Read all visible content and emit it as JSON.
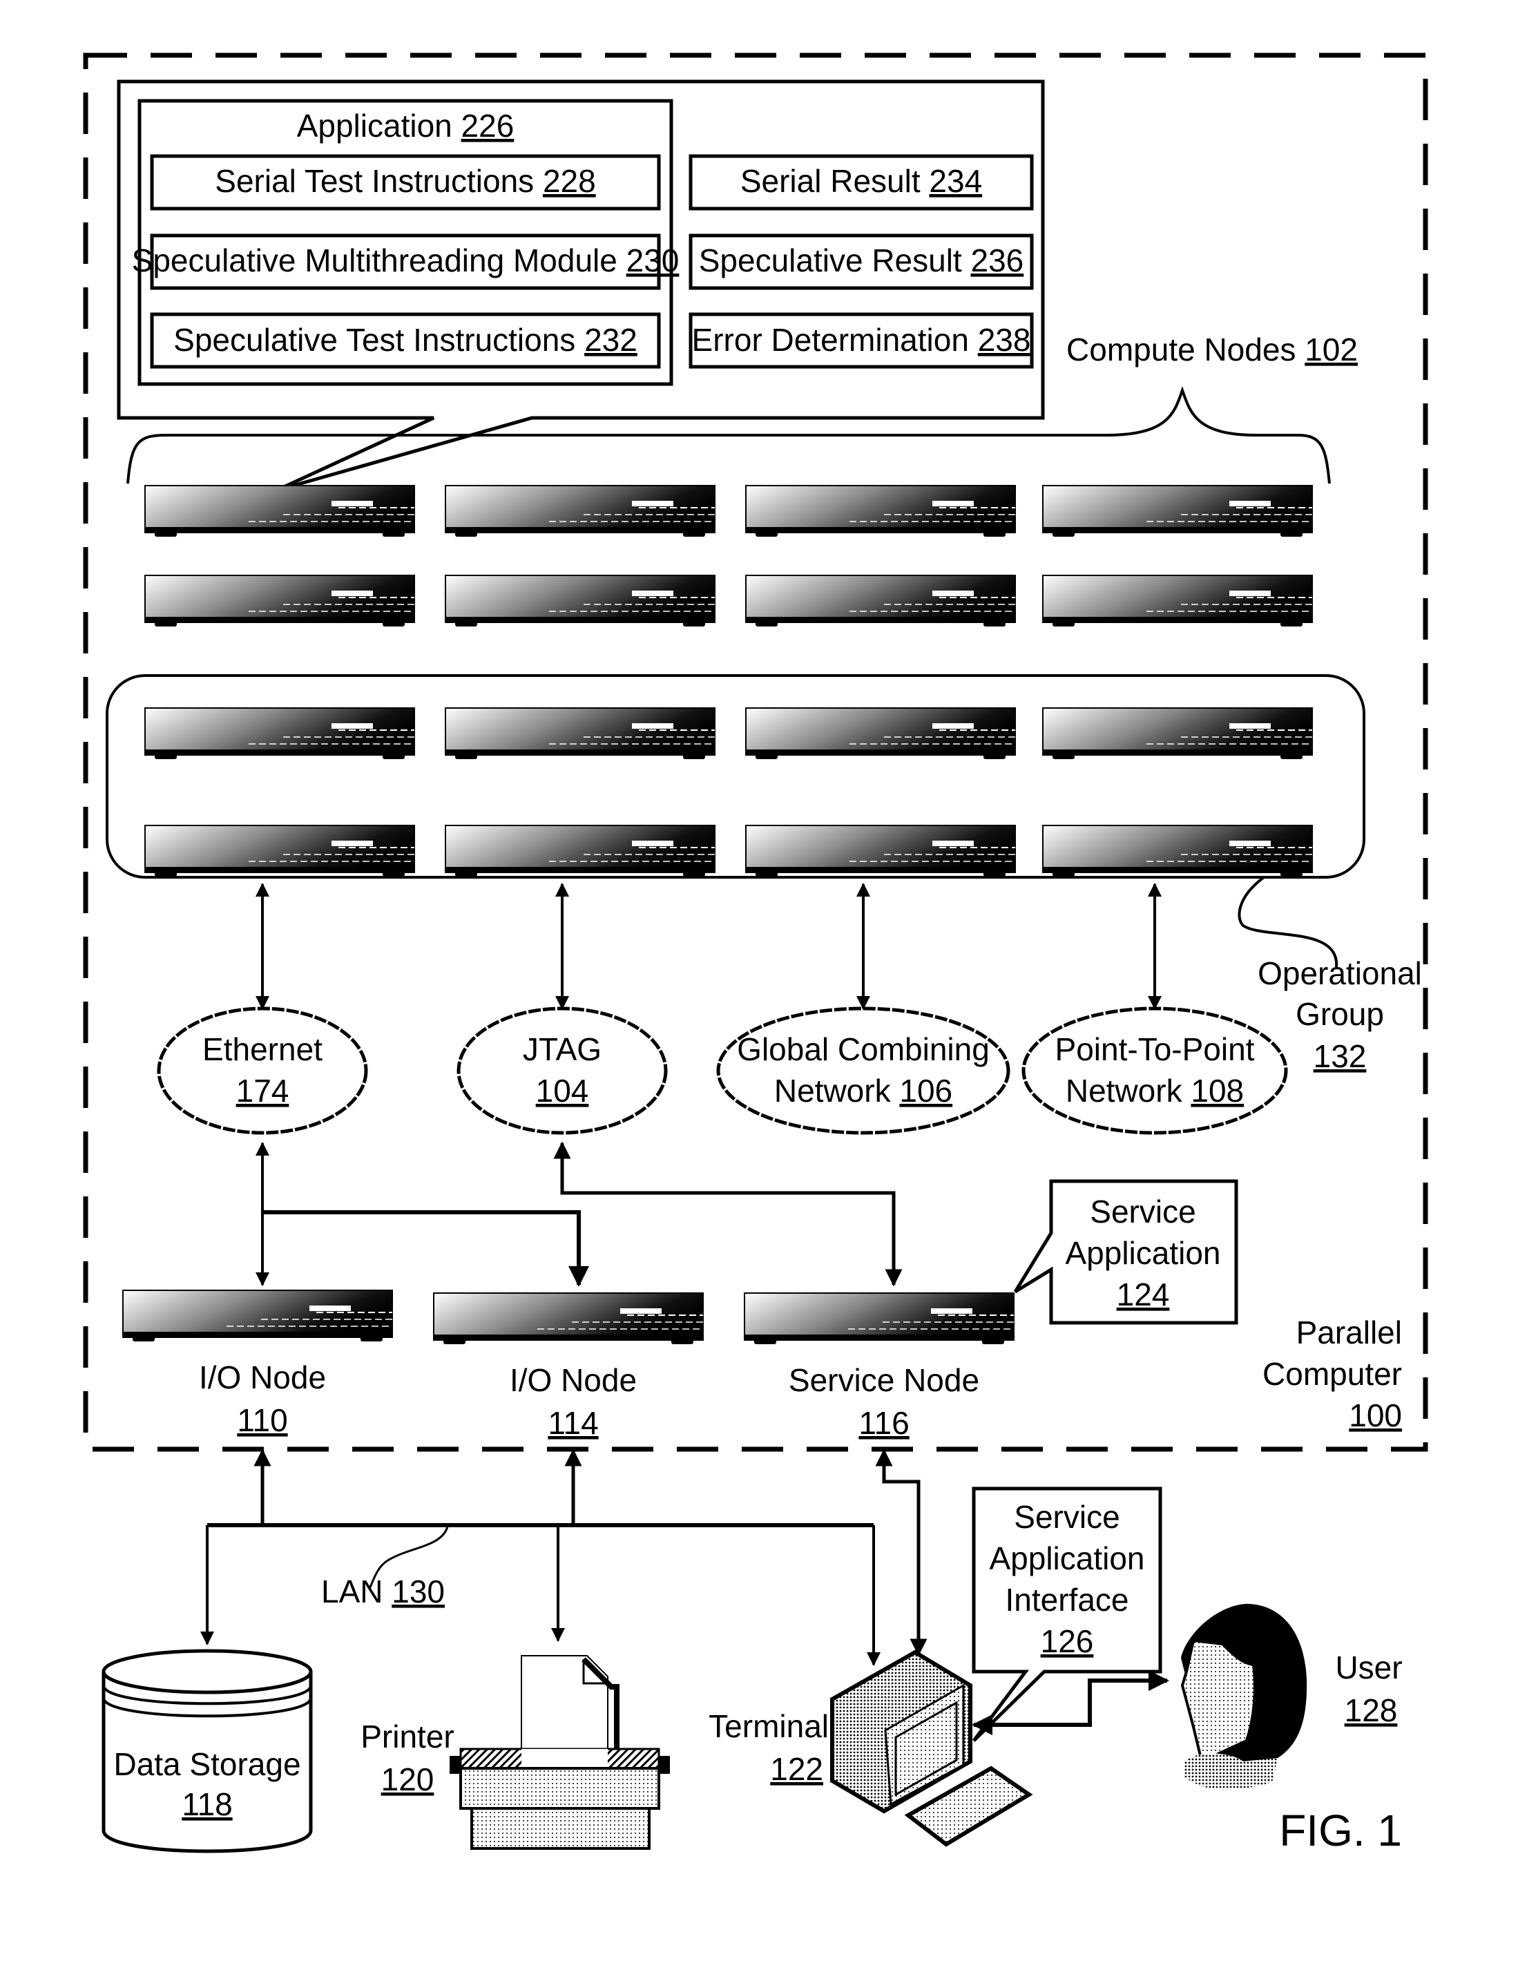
{
  "figure": {
    "caption": "FIG. 1",
    "colors": {
      "ink": "#000000",
      "paper": "#ffffff"
    }
  },
  "parallel_computer": {
    "label_lines": [
      "Parallel",
      "Computer"
    ],
    "ref": "100"
  },
  "application_callout": {
    "application": {
      "label": "Application",
      "ref": "226"
    },
    "left_boxes": [
      {
        "label": "Serial Test Instructions",
        "ref": "228"
      },
      {
        "label": "Speculative Multithreading Module",
        "ref": "230"
      },
      {
        "label": "Speculative Test Instructions",
        "ref": "232"
      }
    ],
    "right_boxes": [
      {
        "label": "Serial Result",
        "ref": "234"
      },
      {
        "label": "Speculative Result",
        "ref": "236"
      },
      {
        "label": "Error Determination",
        "ref": "238"
      }
    ]
  },
  "compute_nodes": {
    "label": "Compute Nodes",
    "ref": "102",
    "rows": 4,
    "cols": 4
  },
  "operational_group": {
    "label_lines": [
      "Operational",
      "Group"
    ],
    "ref": "132"
  },
  "networks": [
    {
      "line1": "Ethernet",
      "line2": "",
      "ref": "174"
    },
    {
      "line1": "JTAG",
      "line2": "",
      "ref": "104"
    },
    {
      "line1": "Global Combining",
      "line2": "Network",
      "ref": "106"
    },
    {
      "line1": "Point-To-Point",
      "line2": "Network",
      "ref": "108"
    }
  ],
  "service_nodes": [
    {
      "label": "I/O Node",
      "ref": "110"
    },
    {
      "label": "I/O Node",
      "ref": "114"
    },
    {
      "label": "Service Node",
      "ref": "116"
    }
  ],
  "service_application": {
    "label_lines": [
      "Service",
      "Application"
    ],
    "ref": "124"
  },
  "lan": {
    "label": "LAN",
    "ref": "130"
  },
  "peripherals": {
    "data_storage": {
      "label": "Data Storage",
      "ref": "118"
    },
    "printer": {
      "label": "Printer",
      "ref": "120"
    },
    "terminal": {
      "label": "Terminal",
      "ref": "122"
    },
    "user": {
      "label": "User",
      "ref": "128"
    }
  },
  "service_application_interface": {
    "label_lines": [
      "Service",
      "Application",
      "Interface"
    ],
    "ref": "126"
  }
}
